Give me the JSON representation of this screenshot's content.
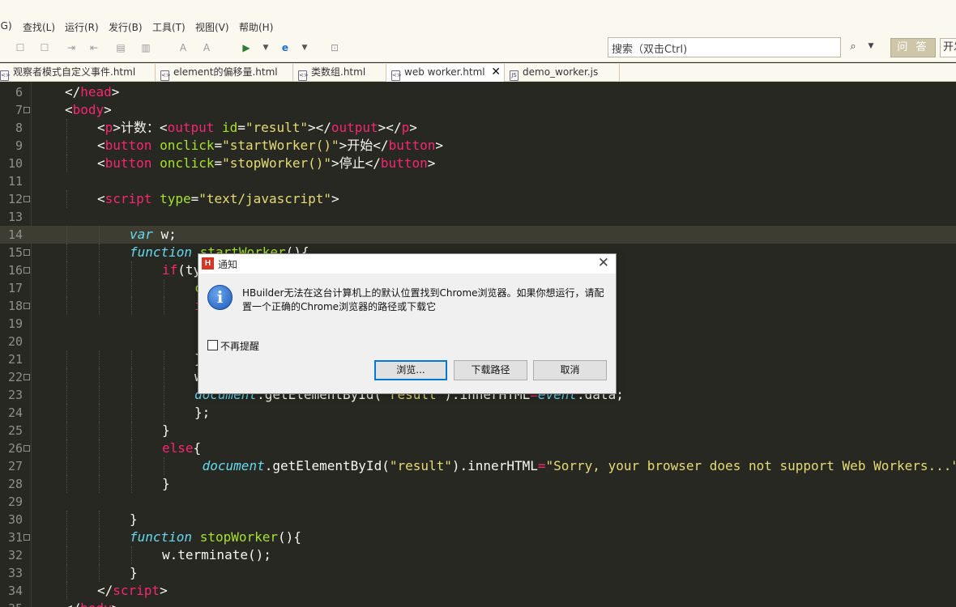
{
  "menu": [
    "(G)",
    "查找(L)",
    "运行(R)",
    "发行(B)",
    "工具(T)",
    "视图(V)",
    "帮助(H)"
  ],
  "toolbar": {
    "search_placeholder": "搜索（双击Ctrl)",
    "search_icon": "magnifier-icon",
    "qa_label": "问 答",
    "open_label": "开发"
  },
  "tabs": [
    {
      "label": "观察者模式自定义事件.html",
      "icon": "html-file-icon",
      "active": false
    },
    {
      "label": "element的偏移量.html",
      "icon": "html-file-icon",
      "active": false
    },
    {
      "label": "类数组.html",
      "icon": "html-file-icon",
      "active": false
    },
    {
      "label": "web worker.html",
      "icon": "html-file-icon",
      "active": true
    },
    {
      "label": "demo_worker.js",
      "icon": "js-file-icon",
      "active": false
    }
  ],
  "tab_close_glyph": "✕",
  "editor": {
    "current_line": 14,
    "lines": [
      {
        "n": "6",
        "fold": false,
        "i": 1,
        "t": [
          [
            "p",
            "</"
          ],
          [
            "t",
            "head"
          ],
          [
            "p",
            ">"
          ]
        ]
      },
      {
        "n": "7",
        "fold": true,
        "i": 1,
        "t": [
          [
            "p",
            "<"
          ],
          [
            "t",
            "body"
          ],
          [
            "p",
            ">"
          ]
        ]
      },
      {
        "n": "8",
        "fold": false,
        "i": 2,
        "t": [
          [
            "p",
            "<"
          ],
          [
            "t",
            "p"
          ],
          [
            "p",
            ">计数："
          ],
          [
            "p",
            "<"
          ],
          [
            "t",
            "output"
          ],
          [
            "p",
            " "
          ],
          [
            "a",
            "id"
          ],
          [
            "p",
            "="
          ],
          [
            "s",
            "\"result\""
          ],
          [
            "p",
            "></"
          ],
          [
            "t",
            "output"
          ],
          [
            "p",
            "></"
          ],
          [
            "t",
            "p"
          ],
          [
            "p",
            ">"
          ]
        ]
      },
      {
        "n": "9",
        "fold": false,
        "i": 2,
        "t": [
          [
            "p",
            "<"
          ],
          [
            "t",
            "button"
          ],
          [
            "p",
            " "
          ],
          [
            "a",
            "onclick"
          ],
          [
            "p",
            "="
          ],
          [
            "s",
            "\"startWorker()\""
          ],
          [
            "p",
            ">开始</"
          ],
          [
            "t",
            "button"
          ],
          [
            "p",
            ">"
          ]
        ]
      },
      {
        "n": "10",
        "fold": false,
        "i": 2,
        "t": [
          [
            "p",
            "<"
          ],
          [
            "t",
            "button"
          ],
          [
            "p",
            " "
          ],
          [
            "a",
            "onclick"
          ],
          [
            "p",
            "="
          ],
          [
            "s",
            "\"stopWorker()\""
          ],
          [
            "p",
            ">停止</"
          ],
          [
            "t",
            "button"
          ],
          [
            "p",
            ">"
          ]
        ]
      },
      {
        "n": "11",
        "fold": false,
        "i": 0,
        "t": []
      },
      {
        "n": "12",
        "fold": true,
        "i": 2,
        "t": [
          [
            "p",
            "<"
          ],
          [
            "t",
            "script"
          ],
          [
            "p",
            " "
          ],
          [
            "a",
            "type"
          ],
          [
            "p",
            "="
          ],
          [
            "s",
            "\"text/javascript\""
          ],
          [
            "p",
            ">"
          ]
        ]
      },
      {
        "n": "13",
        "fold": false,
        "i": 0,
        "t": []
      },
      {
        "n": "14",
        "fold": false,
        "i": 3,
        "t": [
          [
            "k",
            "var"
          ],
          [
            "p",
            " w;"
          ]
        ]
      },
      {
        "n": "15",
        "fold": true,
        "i": 3,
        "t": [
          [
            "k",
            "function"
          ],
          [
            "p",
            " "
          ],
          [
            "f",
            "startWorker"
          ],
          [
            "p",
            "(){"
          ]
        ]
      },
      {
        "n": "16",
        "fold": true,
        "i": 4,
        "t": [
          [
            "t",
            "if"
          ],
          [
            "p",
            "(ty"
          ]
        ]
      },
      {
        "n": "17",
        "fold": false,
        "i": 5,
        "t": [
          [
            "a",
            "c"
          ]
        ]
      },
      {
        "n": "18",
        "fold": true,
        "i": 5,
        "t": [
          [
            "t",
            "i"
          ]
        ]
      },
      {
        "n": "19",
        "fold": false,
        "i": 0,
        "t": []
      },
      {
        "n": "20",
        "fold": false,
        "i": 0,
        "t": []
      },
      {
        "n": "21",
        "fold": false,
        "i": 5,
        "t": [
          [
            "p",
            "}"
          ]
        ]
      },
      {
        "n": "22",
        "fold": true,
        "i": 5,
        "t": [
          [
            "p",
            "w"
          ]
        ]
      },
      {
        "n": "23",
        "fold": false,
        "i": 5,
        "t": [
          [
            "k",
            "document"
          ],
          [
            "p",
            ".getElementById("
          ],
          [
            "s",
            "\"result\""
          ],
          [
            "p",
            ").innerHTML"
          ],
          [
            "t",
            "="
          ],
          [
            "k",
            "event"
          ],
          [
            "p",
            ".data;"
          ]
        ]
      },
      {
        "n": "24",
        "fold": false,
        "i": 5,
        "t": [
          [
            "p",
            "};"
          ]
        ]
      },
      {
        "n": "25",
        "fold": false,
        "i": 4,
        "t": [
          [
            "p",
            "}"
          ]
        ]
      },
      {
        "n": "26",
        "fold": true,
        "i": 4,
        "t": [
          [
            "t",
            "else"
          ],
          [
            "p",
            "{"
          ]
        ]
      },
      {
        "n": "27",
        "fold": false,
        "i": 5,
        "t": [
          [
            "p",
            " "
          ],
          [
            "k",
            "document"
          ],
          [
            "p",
            ".getElementById("
          ],
          [
            "s",
            "\"result\""
          ],
          [
            "p",
            ").innerHTML"
          ],
          [
            "t",
            "="
          ],
          [
            "s",
            "\"Sorry, your browser does not support Web Workers...\""
          ],
          [
            "p",
            ";"
          ]
        ]
      },
      {
        "n": "28",
        "fold": false,
        "i": 4,
        "t": [
          [
            "p",
            "}"
          ]
        ]
      },
      {
        "n": "29",
        "fold": false,
        "i": 0,
        "t": []
      },
      {
        "n": "30",
        "fold": false,
        "i": 3,
        "t": [
          [
            "p",
            "}"
          ]
        ]
      },
      {
        "n": "31",
        "fold": true,
        "i": 3,
        "t": [
          [
            "k",
            "function"
          ],
          [
            "p",
            " "
          ],
          [
            "f",
            "stopWorker"
          ],
          [
            "p",
            "(){"
          ]
        ]
      },
      {
        "n": "32",
        "fold": false,
        "i": 4,
        "t": [
          [
            "p",
            "w.terminate();"
          ]
        ]
      },
      {
        "n": "33",
        "fold": false,
        "i": 3,
        "t": [
          [
            "p",
            "}"
          ]
        ]
      },
      {
        "n": "34",
        "fold": false,
        "i": 2,
        "t": [
          [
            "p",
            "</"
          ],
          [
            "t",
            "script"
          ],
          [
            "p",
            ">"
          ]
        ]
      },
      {
        "n": "35",
        "fold": false,
        "i": 1,
        "t": [
          [
            "p",
            "</"
          ],
          [
            "t",
            "body"
          ],
          [
            "p",
            ">"
          ]
        ]
      }
    ]
  },
  "dialog": {
    "logo": "H",
    "title": "通知",
    "close_glyph": "✕",
    "icon": "information-icon",
    "icon_glyph": "i",
    "message": "HBuilder无法在这台计算机上的默认位置找到Chrome浏览器。如果你想运行，请配置一个正确的Chrome浏览器的路径或下载它",
    "checkbox_label": "不再提醒",
    "checkbox_checked": false,
    "buttons": {
      "browse": "浏览...",
      "download": "下载路径",
      "cancel": "取消"
    }
  }
}
